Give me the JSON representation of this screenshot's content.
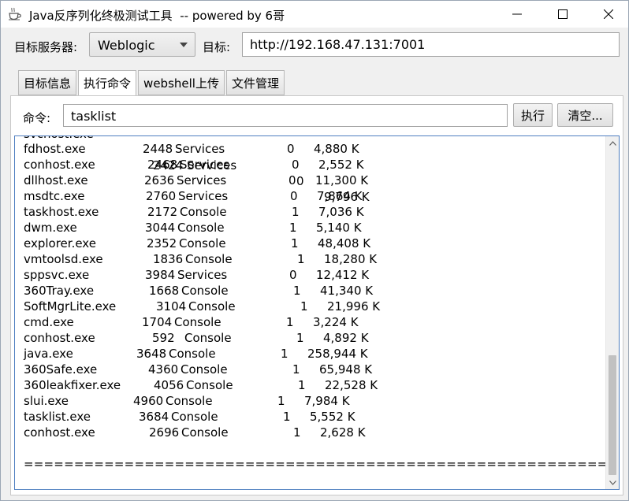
{
  "window": {
    "title": "Java反序列化终极测试工具  -- powered by 6哥",
    "icon": "java-cup-icon"
  },
  "controls": {
    "minimize": "minimize-icon",
    "maximize": "maximize-icon",
    "close": "close-icon"
  },
  "server_row": {
    "server_label": "目标服务器:",
    "server_value": "Weblogic",
    "target_label": "目标:",
    "target_value": "http://192.168.47.131:7001"
  },
  "tabs": [
    {
      "label": "目标信息",
      "active": false
    },
    {
      "label": "执行命令",
      "active": true
    },
    {
      "label": "webshell上传",
      "active": false
    },
    {
      "label": "文件管理",
      "active": false
    }
  ],
  "command": {
    "label": "命令:",
    "value": "tasklist",
    "exec_label": "执行",
    "clear_label": "清空..."
  },
  "output": {
    "rows": [
      {
        "name": "fdhost.exe",
        "pid": "2448",
        "session": "Services",
        "num": "0",
        "mem": "4,880 K"
      },
      {
        "name": "conhost.exe",
        "pid": "2468",
        "session": "Services",
        "num": "0",
        "mem": "2,552 K"
      },
      {
        "name": "dllhost.exe",
        "pid": "2636",
        "session": "Services",
        "num": "0",
        "mem": "11,300 K"
      },
      {
        "name": "msdtc.exe",
        "pid": "2760",
        "session": "Services",
        "num": "0",
        "mem": "7,864 K"
      },
      {
        "name": "taskhost.exe",
        "pid": "2172",
        "session": "Console",
        "num": "1",
        "mem": "7,036 K"
      },
      {
        "name": "dwm.exe",
        "pid": "3044",
        "session": "Console",
        "num": "1",
        "mem": "5,140 K"
      },
      {
        "name": "explorer.exe",
        "pid": "2352",
        "session": "Console",
        "num": "1",
        "mem": "48,408 K"
      },
      {
        "name": "vmtoolsd.exe",
        "pid": "1836",
        "session": "Console",
        "num": "1",
        "mem": "18,280 K"
      },
      {
        "name": "sppsvc.exe",
        "pid": "3984",
        "session": "Services",
        "num": "0",
        "mem": "12,412 K"
      },
      {
        "name": "360Tray.exe",
        "pid": "1668",
        "session": "Console",
        "num": "1",
        "mem": "41,340 K"
      },
      {
        "name": "SoftMgrLite.exe",
        "pid": "3104",
        "session": "Console",
        "num": "1",
        "mem": "21,996 K"
      },
      {
        "name": "cmd.exe",
        "pid": "1704",
        "session": "Console",
        "num": "1",
        "mem": "3,224 K"
      },
      {
        "name": "conhost.exe",
        "pid": "592",
        "session": "Console",
        "num": "1",
        "mem": "4,892 K"
      },
      {
        "name": "java.exe",
        "pid": "3648",
        "session": "Console",
        "num": "1",
        "mem": "258,944 K"
      },
      {
        "name": "360Safe.exe",
        "pid": "4360",
        "session": "Console",
        "num": "1",
        "mem": "65,948 K"
      },
      {
        "name": "360leakfixer.exe",
        "pid": "4056",
        "session": "Console",
        "num": "1",
        "mem": "22,528 K"
      },
      {
        "name": "slui.exe",
        "pid": "4960",
        "session": "Console",
        "num": "1",
        "mem": "7,984 K"
      },
      {
        "name": "tasklist.exe",
        "pid": "3684",
        "session": "Console",
        "num": "1",
        "mem": "5,552 K"
      },
      {
        "name": "conhost.exe",
        "pid": "2696",
        "session": "Console",
        "num": "1",
        "mem": "2,628 K"
      }
    ],
    "separator": "=============================================================================="
  },
  "icons": {
    "scroll_up": "scroll-up-arrow-icon",
    "scroll_down": "scroll-down-arrow-icon",
    "combo_arrow": "chevron-down-icon"
  }
}
